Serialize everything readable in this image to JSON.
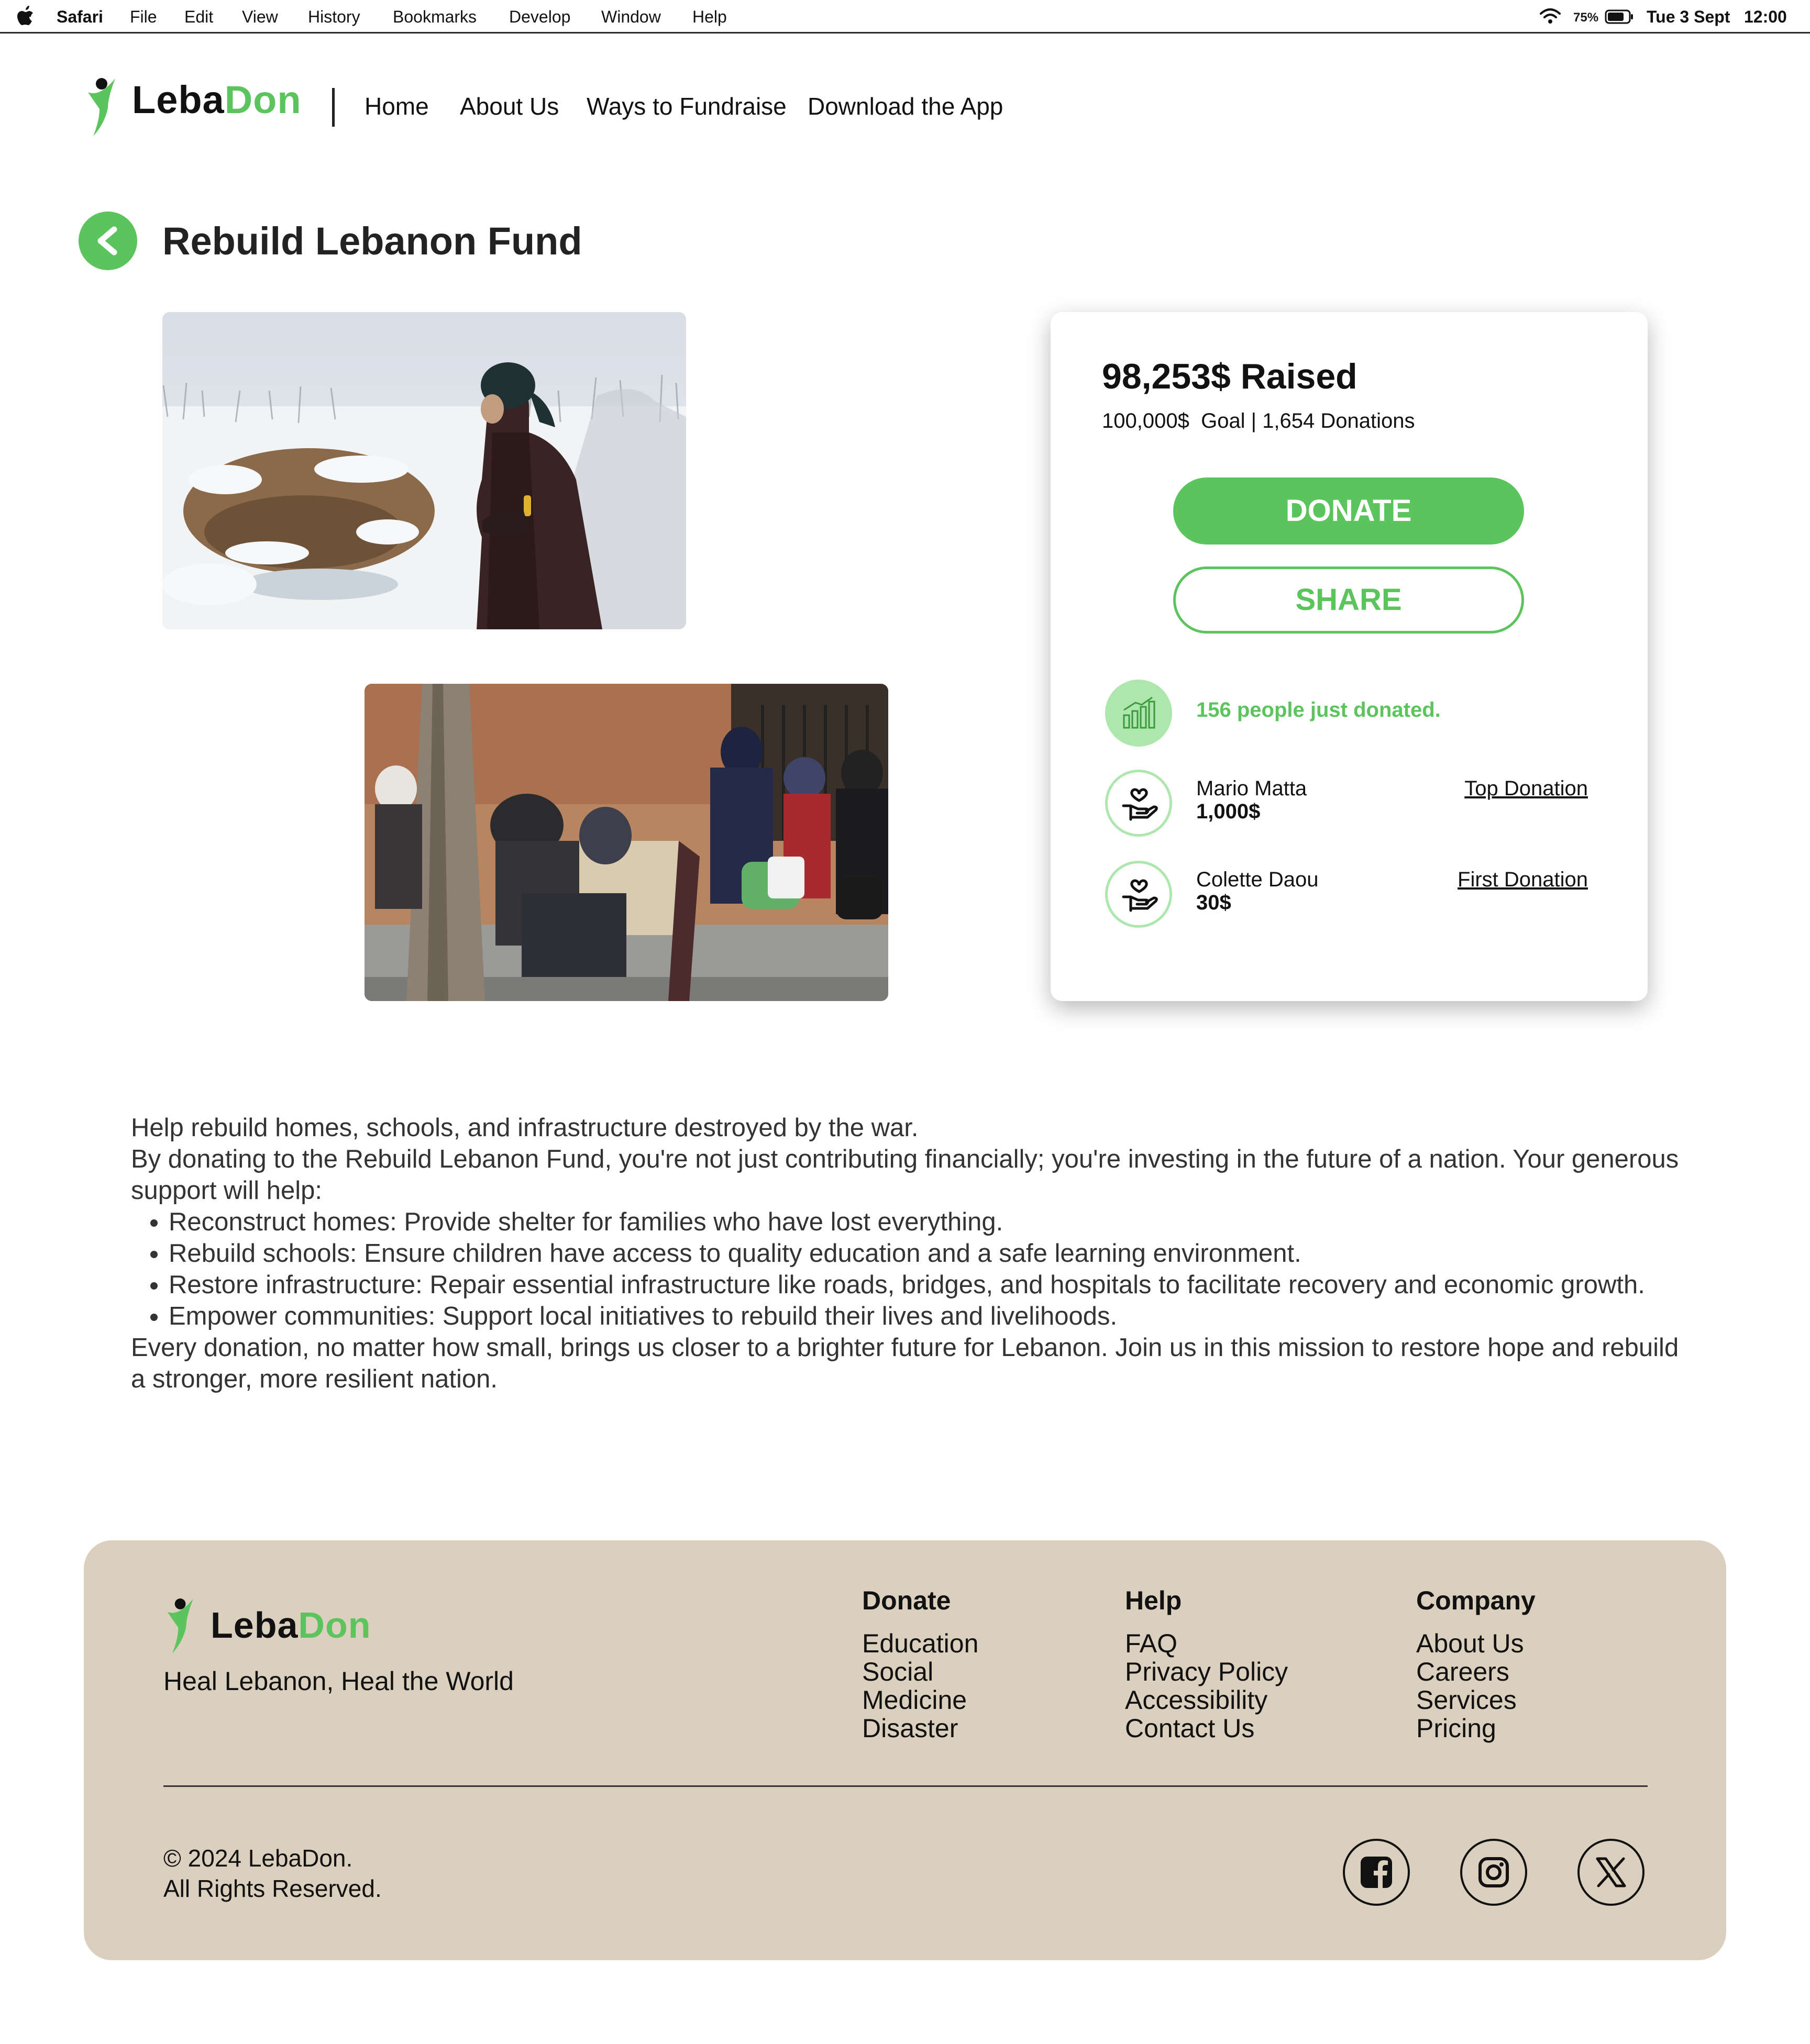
{
  "menubar": {
    "app": "Safari",
    "items": [
      "File",
      "Edit",
      "View",
      "History",
      "Bookmarks",
      "Develop",
      "Window",
      "Help"
    ],
    "battery": "75%",
    "date": "Tue 3 Sept",
    "time": "12:00"
  },
  "brand": {
    "part1": "Leba",
    "part2": "Don",
    "accent_color": "#5cc45c"
  },
  "nav": [
    "Home",
    "About Us",
    "Ways to Fundraise",
    "Download the App"
  ],
  "page": {
    "back_symbol": "<",
    "title": "Rebuild Lebanon Fund"
  },
  "card": {
    "raised": "98,253$ Raised",
    "goal_amount": "100,000$",
    "goal_label": "Goal | 1,654 Donations",
    "donate_label": "DONATE",
    "share_label": "SHARE",
    "recent": "156 people just donated.",
    "donors": [
      {
        "name": "Mario Matta",
        "amount": "1,000$",
        "tag": "Top Donation"
      },
      {
        "name": "Colette Daou",
        "amount": "30$",
        "tag": "First Donation"
      }
    ]
  },
  "description": {
    "intro": "Help rebuild homes, schools, and infrastructure destroyed by the war.",
    "para": "By donating to the Rebuild Lebanon Fund, you're not just contributing financially; you're investing in the future of a nation. Your generous support will help:",
    "bullets": [
      "Reconstruct homes: Provide shelter for families who have lost everything.",
      "Rebuild schools: Ensure children have access to quality education and a safe learning environment.",
      "Restore infrastructure: Repair essential infrastructure like roads, bridges, and hospitals to facilitate recovery and economic growth.",
      "Empower communities: Support local initiatives to rebuild their lives and livelihoods."
    ],
    "closing": "Every donation, no matter how small, brings us closer to a brighter future for Lebanon. Join us in this mission to restore hope and rebuild a stronger, more resilient nation."
  },
  "footer": {
    "tagline": "Heal Lebanon, Heal the World",
    "columns": [
      {
        "title": "Donate",
        "links": [
          "Education",
          "Social",
          "Medicine",
          "Disaster"
        ]
      },
      {
        "title": "Help",
        "links": [
          "FAQ",
          "Privacy Policy",
          "Accessibility",
          "Contact Us"
        ]
      },
      {
        "title": "Company",
        "links": [
          "About Us",
          "Careers",
          "Services",
          "Pricing"
        ]
      }
    ],
    "copyright_line1": "© 2024 LebaDon.",
    "copyright_line2": "All Rights Reserved.",
    "background": "#dbcfbd"
  }
}
